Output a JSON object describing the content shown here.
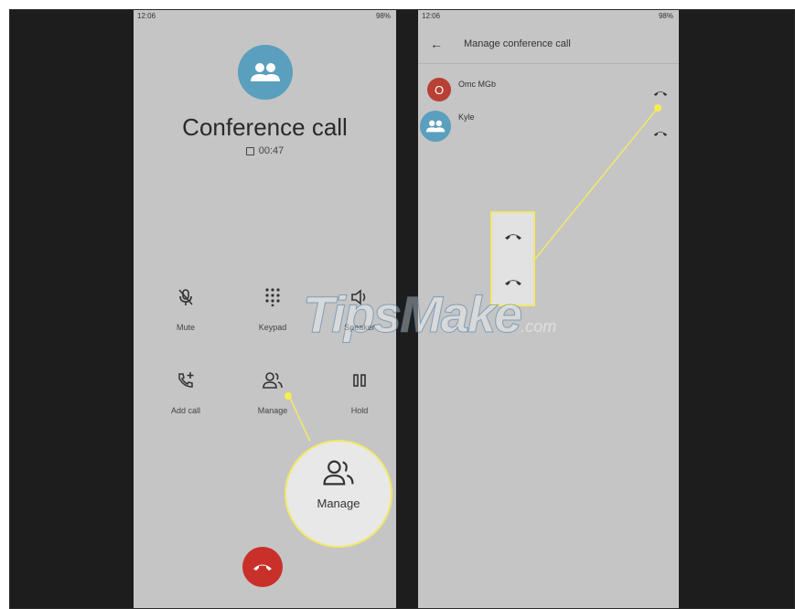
{
  "left_screen": {
    "status_time": "12:06",
    "status_battery": "98%",
    "title": "Conference call",
    "timer": "00:47",
    "controls": [
      {
        "label": "Mute",
        "icon": "mic-off-icon"
      },
      {
        "label": "Keypad",
        "icon": "keypad-icon"
      },
      {
        "label": "Speaker",
        "icon": "speaker-icon"
      },
      {
        "label": "Add call",
        "icon": "add-call-icon"
      },
      {
        "label": "Manage",
        "icon": "manage-people-icon"
      },
      {
        "label": "Hold",
        "icon": "pause-icon"
      }
    ],
    "magnified_label": "Manage"
  },
  "right_screen": {
    "status_time": "12:06",
    "status_battery": "98%",
    "title": "Manage conference call",
    "participants": [
      {
        "name": "Omc MGb",
        "initial": "O"
      },
      {
        "name": "Kyle"
      }
    ]
  },
  "watermark": {
    "brand": "TipsMake",
    "domain": ".com"
  },
  "colors": {
    "end_call": "#c9302a",
    "avatar": "#5a9fbd",
    "highlight": "#f2e86a",
    "participant_avatar": "#b84034"
  }
}
